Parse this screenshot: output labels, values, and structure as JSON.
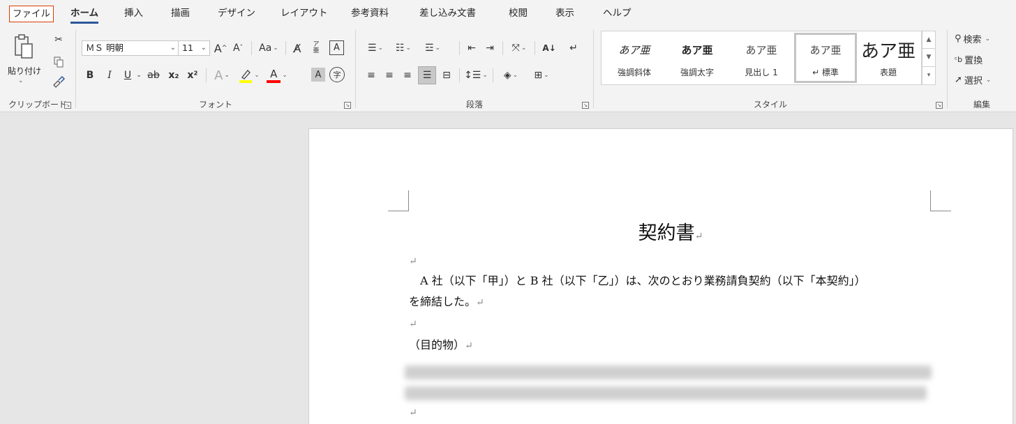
{
  "tabs": [
    "ファイル",
    "ホーム",
    "挿入",
    "描画",
    "デザイン",
    "レイアウト",
    "参考資料",
    "差し込み文書",
    "校閲",
    "表示",
    "ヘルプ"
  ],
  "clipboard": {
    "paste_label": "貼り付け",
    "group_label": "クリップボード"
  },
  "font": {
    "font_name": "ＭＳ 明朝",
    "font_size": "11",
    "group_label": "フォント",
    "grow": "A",
    "shrink": "A",
    "case": "Aa",
    "bold": "B",
    "italic": "I",
    "underline": "U",
    "strike": "ab",
    "subscript": "x₂",
    "superscript": "x²",
    "highlight_color": "#ffff00",
    "font_color": "#ff0000",
    "char_shade": "A",
    "enclose": "字"
  },
  "paragraph": {
    "group_label": "段落"
  },
  "styles": {
    "group_label": "スタイル",
    "items": [
      {
        "preview": "あア亜",
        "name": "強調斜体"
      },
      {
        "preview": "あア亜",
        "name": "強調太字"
      },
      {
        "preview": "あア亜",
        "name": "見出し 1"
      },
      {
        "preview": "あア亜",
        "name": "↵ 標準"
      },
      {
        "preview": "あア亜",
        "name": "表題"
      }
    ]
  },
  "editing": {
    "group_label": "編集",
    "find": "検索",
    "replace": "置換",
    "select": "選択"
  },
  "document": {
    "title": "契約書",
    "mark": "↵",
    "para1_line1": "　A 社（以下「甲」）と B 社（以下「乙」）は、次のとおり業務請負契約（以下「本契約」）",
    "para1_line2": "を締結した。",
    "heading1": "（目的物）"
  }
}
